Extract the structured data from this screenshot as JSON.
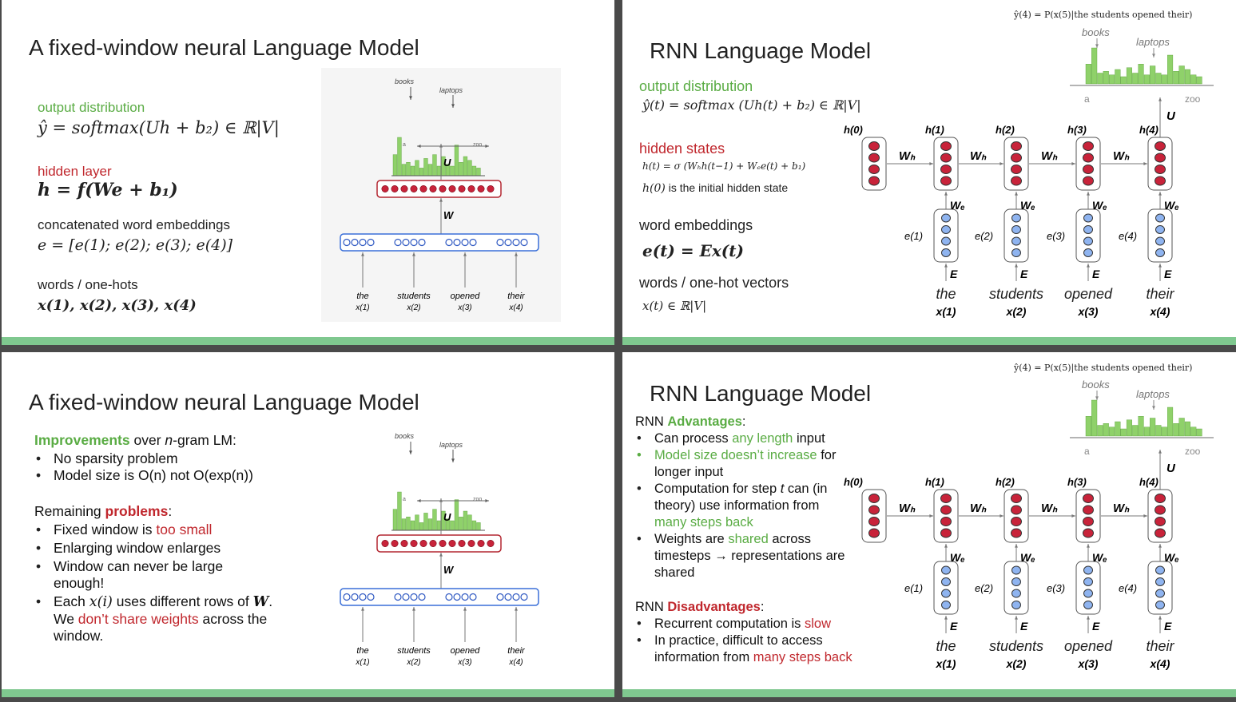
{
  "slide1": {
    "title": "A fixed-window neural Language Model",
    "output_label": "output distribution",
    "output_eq": "ŷ = softmax(Uh + b₂) ∈ ℝ|V|",
    "hidden_label": "hidden layer",
    "hidden_eq": "h = f(We + b₁)",
    "concat_label": "concatenated word embeddings",
    "concat_eq": "e = [e(1); e(2); e(3); e(4)]",
    "words_label": "words / one-hots",
    "words_eq": "x(1), x(2), x(3), x(4)"
  },
  "fw_diagram": {
    "books": "books",
    "laptops": "laptops",
    "a": "a",
    "zoo": "zoo",
    "U": "U",
    "W": "W",
    "words": [
      "the",
      "students",
      "opened",
      "their"
    ],
    "xs": [
      "x(1)",
      "x(2)",
      "x(3)",
      "x(4)"
    ]
  },
  "slide2": {
    "title": "RNN Language Model",
    "prob_header": "ŷ(4) = P(x(5)|the students opened their)",
    "output_label": "output distribution",
    "output_eq": "ŷ(t) = softmax (Uh(t) + b₂) ∈ ℝ|V|",
    "hidden_label": "hidden states",
    "hidden_eq": "h(t) = σ (Wₕh(t−1) + Wₑe(t) + b₁)",
    "h0_note": "is the initial hidden state",
    "h0_sym": "h(0)",
    "emb_label": "word embeddings",
    "emb_eq": "e(t) = Ex(t)",
    "words_label": "words / one-hot vectors",
    "words_eq": "x(t) ∈ ℝ|V|"
  },
  "rnn_diagram": {
    "books": "books",
    "laptops": "laptops",
    "a": "a",
    "zoo": "zoo",
    "U": "U",
    "Wh": "Wₕ",
    "We": "Wₑ",
    "E": "E",
    "hs": [
      "h(0)",
      "h(1)",
      "h(2)",
      "h(3)",
      "h(4)"
    ],
    "es": [
      "e(1)",
      "e(2)",
      "e(3)",
      "e(4)"
    ],
    "words": [
      "the",
      "students",
      "opened",
      "their"
    ],
    "xs": [
      "x(1)",
      "x(2)",
      "x(3)",
      "x(4)"
    ]
  },
  "slide3": {
    "title": "A fixed-window neural Language Model",
    "impr_word": "Improvements",
    "impr_rest_1": " over ",
    "impr_n": "n",
    "impr_rest_2": "-gram LM:",
    "impr_items": [
      "No sparsity problem",
      "Model size is O(n) not O(exp(n))"
    ],
    "rem_1": "Remaining ",
    "rem_word": "problems",
    "rem_2": ":",
    "p1_a": "Fixed window is ",
    "p1_b": "too small",
    "p2": "Enlarging window enlarges",
    "p3": "Window can never be large enough!",
    "p4_a": "Each ",
    "p4_x": "x(i)",
    "p4_b": " uses different rows of ",
    "p4_w": "W",
    "p4_c": ". We ",
    "p4_d": "don’t share weights",
    "p4_e": " across the window."
  },
  "slide4": {
    "title": "RNN Language Model",
    "prob_header": "ŷ(4) = P(x(5)|the students opened their)",
    "adv_1": "RNN ",
    "adv_word": "Advantages",
    "adv_2": ":",
    "a1_a": "Can process ",
    "a1_b": "any length",
    "a1_c": " input",
    "a2_a": "Model size doesn’t increase",
    "a2_b": " for longer input",
    "a3_a": "Computation for step ",
    "a3_t": "t",
    "a3_b": " can (in theory) use information from ",
    "a3_c": "many steps back",
    "a4_a": "Weights are ",
    "a4_b": "shared",
    "a4_c": " across timesteps → representations are shared",
    "dis_1": "RNN ",
    "dis_word": "Disadvantages",
    "dis_2": ":",
    "d1_a": "Recurrent computation is ",
    "d1_b": "slow",
    "d2_a": "In practice, difficult to access information from ",
    "d2_b": "many steps back"
  },
  "colors": {
    "green": "#5aac44",
    "red": "#c0272d",
    "hidden_node": "#c8233a",
    "embed_node": "#8fb4f0",
    "hist_bar": "#8fd16a",
    "footer_bar": "#7fc88f"
  }
}
